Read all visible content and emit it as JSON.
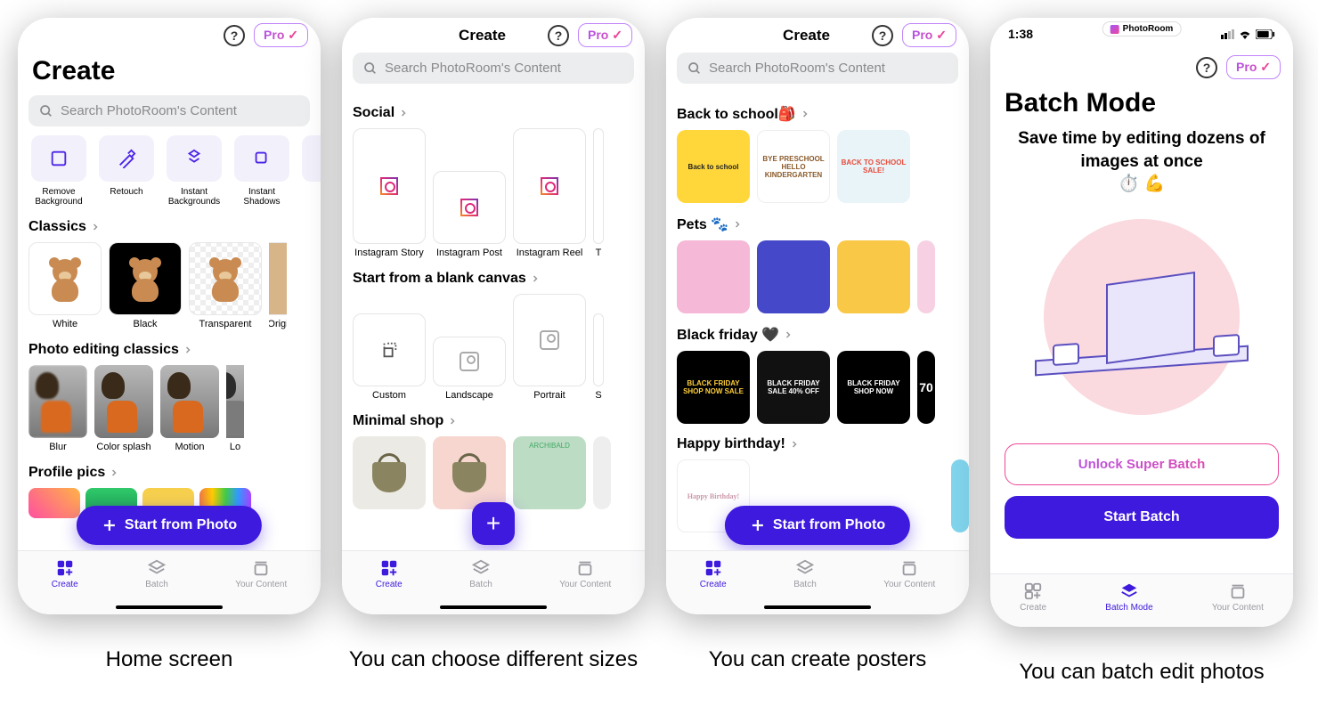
{
  "captions": {
    "screen1": "Home screen",
    "screen2": "You can choose different sizes",
    "screen3": "You can create posters",
    "screen4": "You can batch edit photos"
  },
  "common": {
    "pro_label": "Pro",
    "help_glyph": "?",
    "search_placeholder": "Search PhotoRoom's Content",
    "start_from_photo": "Start from Photo"
  },
  "status": {
    "time": "1:38",
    "app_pill": "PhotoRoom"
  },
  "tabs": {
    "create": "Create",
    "batch": "Batch",
    "batch_mode": "Batch Mode",
    "your_content": "Your Content"
  },
  "screen1": {
    "title": "Create",
    "tools": [
      {
        "label": "Remove Background"
      },
      {
        "label": "Retouch"
      },
      {
        "label": "Instant Backgrounds"
      },
      {
        "label": "Instant Shadows"
      }
    ],
    "sections": {
      "classics": {
        "title": "Classics",
        "items": [
          "White",
          "Black",
          "Transparent",
          "Origi"
        ]
      },
      "editing": {
        "title": "Photo editing classics",
        "items": [
          "Blur",
          "Color splash",
          "Motion",
          "Lo"
        ]
      },
      "profile": {
        "title": "Profile pics"
      }
    }
  },
  "screen2": {
    "title": "Create",
    "sections": {
      "social": {
        "title": "Social",
        "items": [
          "Instagram Story",
          "Instagram Post",
          "Instagram Reel",
          "T"
        ]
      },
      "blank": {
        "title": "Start from a blank canvas",
        "items": [
          "Custom",
          "Landscape",
          "Portrait",
          "S"
        ]
      },
      "minimal": {
        "title": "Minimal shop"
      }
    }
  },
  "screen3": {
    "title": "Create",
    "sections": {
      "back_to_school": {
        "title": "Back to school🎒"
      },
      "pets": {
        "title": "Pets 🐾"
      },
      "black_friday": {
        "title": "Black friday 🖤"
      },
      "birthday": {
        "title": "Happy birthday!"
      }
    },
    "posters": {
      "bf1": "BLACK FRIDAY SHOP NOW SALE",
      "bf2": "BLACK FRIDAY SALE 40% OFF",
      "bf3": "BLACK FRIDAY SHOP NOW",
      "bf4": "70",
      "school1": "Back to school",
      "school2": "BYE PRESCHOOL HELLO KINDERGARTEN",
      "school3": "BACK TO SCHOOL SALE!"
    }
  },
  "screen4": {
    "title": "Batch Mode",
    "hero_title": "Save time by editing dozens of images at once",
    "hero_emoji": "⏱️ 💪",
    "unlock_btn": "Unlock Super Batch",
    "start_btn": "Start Batch"
  }
}
